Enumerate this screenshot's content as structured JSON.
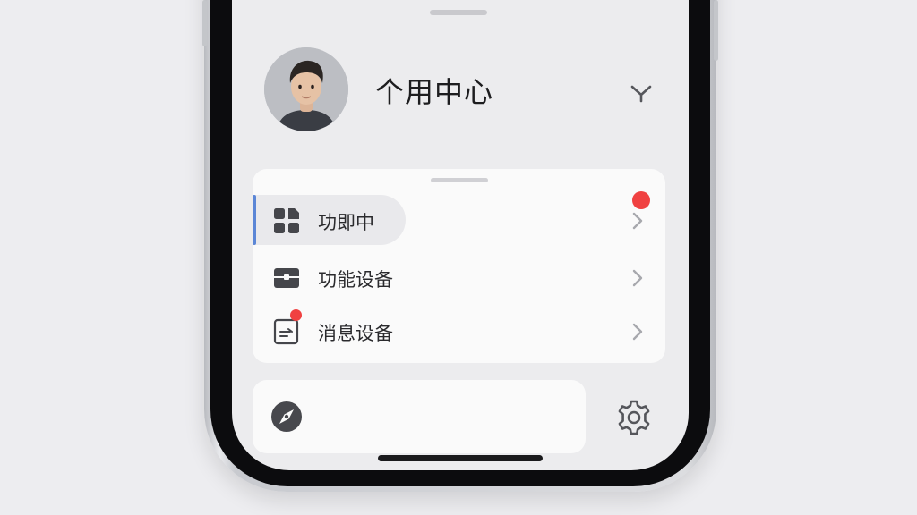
{
  "header": {
    "title": "个用中心"
  },
  "menu": {
    "items": [
      {
        "label": "功即中",
        "icon": "grid-document-icon",
        "selected": true,
        "badge": true
      },
      {
        "label": "功能设备",
        "icon": "briefcase-icon",
        "selected": false,
        "badge": false
      },
      {
        "label": "消息设备",
        "icon": "message-document-icon",
        "selected": false,
        "badge": true
      }
    ]
  },
  "bottom": {
    "left_icon": "compass-icon",
    "right_icon": "gear-icon"
  },
  "colors": {
    "accent": "#5b86d6",
    "badge": "#f04141",
    "background": "#ededf0",
    "card": "#fafafa"
  }
}
